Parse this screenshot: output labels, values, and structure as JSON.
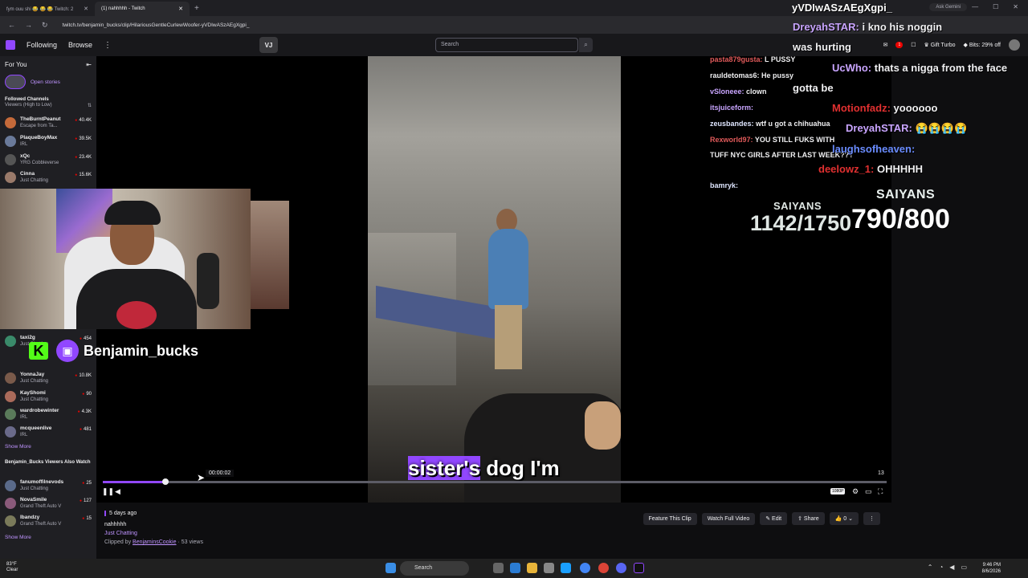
{
  "browser": {
    "tabs": [
      {
        "label": "fym ouu shi 😂 😂 😂 Twitch: 2"
      },
      {
        "label": "(1) nahhhhh - Twitch"
      }
    ],
    "url": "twitch.tv/benjamin_bucks/clip/HilariousGentleCurlewWoofer-yVDIwASzAEgXgpi_",
    "gemini_label": "Ask Gemini"
  },
  "topnav": {
    "following": "Following",
    "browse": "Browse",
    "vj_label": "VJ",
    "search_placeholder": "Search",
    "notif_count": "1",
    "gift_turbo": "Gift Turbo",
    "bits": "Bits: 29% off"
  },
  "sidebar": {
    "for_you": "For You",
    "open_stories": "Open stories",
    "followed_channels": "Followed Channels",
    "sort_label": "Viewers (High to Low)",
    "channels": [
      {
        "name": "TheBurntPeanut",
        "game": "Escape from Ta...",
        "viewers": "40.4K"
      },
      {
        "name": "PlaqueBoyMax",
        "game": "IRL",
        "viewers": "39.5K"
      },
      {
        "name": "xQc",
        "game": "YRG Cobbleverse",
        "viewers": "23.4K"
      },
      {
        "name": "Cinna",
        "game": "Just Chatting",
        "viewers": "15.6K"
      },
      {
        "name": "taxi2g",
        "game": "Just Chatting",
        "viewers": "454"
      },
      {
        "name": "YonnaJay",
        "game": "Just Chatting",
        "viewers": "10.8K"
      },
      {
        "name": "KayShomi",
        "game": "Just Chatting",
        "viewers": "90"
      },
      {
        "name": "wardrobewinter",
        "game": "IRL",
        "viewers": "4.3K"
      },
      {
        "name": "mcqueenlive",
        "game": "IRL",
        "viewers": "481"
      }
    ],
    "show_more": "Show More",
    "also_watch": "Benjamin_Bucks Viewers Also Watch",
    "also_channels": [
      {
        "name": "fanumoffilnevods",
        "game": "Just Chatting",
        "viewers": "25"
      },
      {
        "name": "NovaSmile",
        "game": "Grand Theft Auto V",
        "viewers": "127"
      },
      {
        "name": "lbandzy",
        "game": "Grand Theft Auto V",
        "viewers": "15"
      }
    ],
    "show_more2": "Show More"
  },
  "video": {
    "subtitle_hl": "sister's",
    "subtitle_rest": " dog I'm",
    "time_tip": "00:00:02",
    "end_num": "13",
    "progress_fraction": 0.08,
    "quality": "1080P",
    "webcam_name": "Benjamin_bucks",
    "k_badge": "K"
  },
  "clip_info": {
    "ago": "5 days ago",
    "title": "nahhhhh",
    "category": "Just Chatting",
    "clipped_by_prefix": "Clipped by ",
    "clipper": "BenjaminsCookie",
    "views": " · 53 views",
    "feature": "Feature This Clip",
    "watch_full": "Watch Full Video",
    "edit": "Edit",
    "share": "Share",
    "likes": "0"
  },
  "overlay": {
    "top_id": "yVDIwASzAEgXgpi_",
    "chat_small": [
      {
        "user": "pasta879gusta:",
        "msg": "L PUSSY",
        "color": "#e05a5a"
      },
      {
        "user": "rauldetomas6:",
        "msg": "He pussy",
        "color": "#efeff1"
      },
      {
        "user": "vSloneee:",
        "msg": "clown",
        "color": "#efeff1"
      },
      {
        "user": "itsjuiceform:",
        "msg": "",
        "color": "#efeff1"
      },
      {
        "user": "zeusbandes:",
        "msg": "wtf u got a chihuahua",
        "color": "#efeff1"
      },
      {
        "user": "Rexworld97:",
        "msg": "YOU STILL FUKS WITH",
        "color": "#e05a5a"
      },
      {
        "user": "",
        "msg": "TUFF NYC GIRLS AFTER LAST WEEK???",
        "color": "#efeff1"
      },
      {
        "user": "bamryk:",
        "msg": "",
        "color": "#efeff1"
      }
    ],
    "chat_big": [
      {
        "user": "DreyahSTAR:",
        "msg": "i kno his noggin",
        "color": "#c9a5ff"
      },
      {
        "user": "",
        "msg": "was hurting",
        "color": "#efeff1"
      },
      {
        "user": "UcWho:",
        "msg": "thats a nigga from the face",
        "color": "#c9a5ff"
      },
      {
        "user": "",
        "msg": "gotta be",
        "color": "#efeff1"
      },
      {
        "user": "Motionfadz:",
        "msg": "yoooooo",
        "color": "#e03030"
      },
      {
        "user": "DreyahSTAR:",
        "msg": "😭😭😭😭",
        "color": "#c9a5ff"
      },
      {
        "user": "laughsofheaven:",
        "msg": "",
        "color": "#6a8cff"
      },
      {
        "user": "deelowz_1:",
        "msg": "OHHHHH",
        "color": "#e03030"
      }
    ],
    "goal1_label": "SAIYANS",
    "goal1_value": "1142/1750",
    "goal2_label": "SAIYANS",
    "goal2_value": "790/800"
  },
  "taskbar": {
    "temp": "83°F",
    "weather": "Clear",
    "search": "Search",
    "time": "9:46 PM",
    "date": "8/6/2026"
  }
}
